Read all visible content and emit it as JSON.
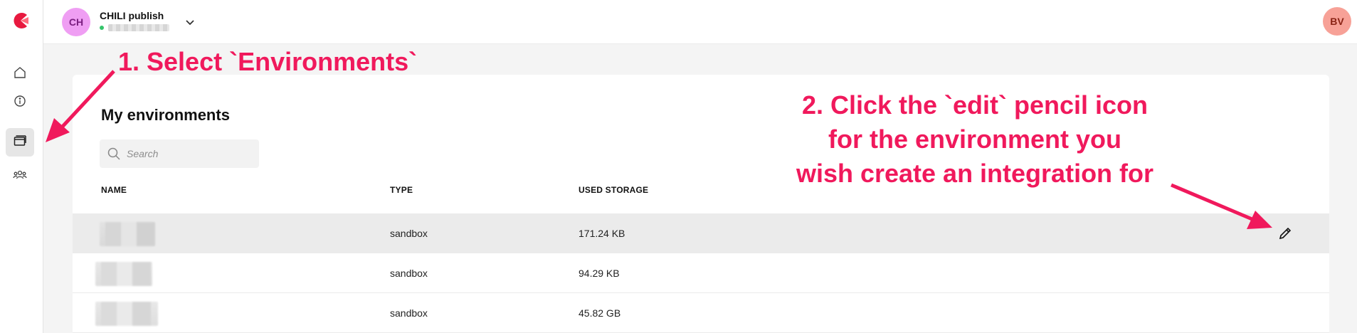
{
  "sidebar": {
    "items": [
      {
        "icon": "home-icon",
        "active": false
      },
      {
        "icon": "info-icon",
        "active": false
      },
      {
        "icon": "environments-icon",
        "active": true
      },
      {
        "icon": "users-icon",
        "active": false
      }
    ]
  },
  "topbar": {
    "workspace_initials": "CH",
    "workspace_name": "CHILI publish",
    "user_initials": "BV"
  },
  "main": {
    "title": "My environments",
    "search": {
      "placeholder": "Search",
      "value": ""
    },
    "columns": [
      "NAME",
      "TYPE",
      "USED STORAGE"
    ],
    "rows": [
      {
        "type": "sandbox",
        "storage": "171.24 KB"
      },
      {
        "type": "sandbox",
        "storage": "94.29 KB"
      },
      {
        "type": "sandbox",
        "storage": "45.82 GB"
      }
    ]
  },
  "annotations": {
    "step1": "1. Select `Environments`",
    "step2_line1": "2. Click the `edit` pencil icon",
    "step2_line2": "for the environment you",
    "step2_line3": "wish create an integration for"
  },
  "colors": {
    "annotation": "#f0195c",
    "workspace_avatar": "#ef9ef3",
    "user_avatar": "#f7a197",
    "logo": "#e8193f"
  }
}
